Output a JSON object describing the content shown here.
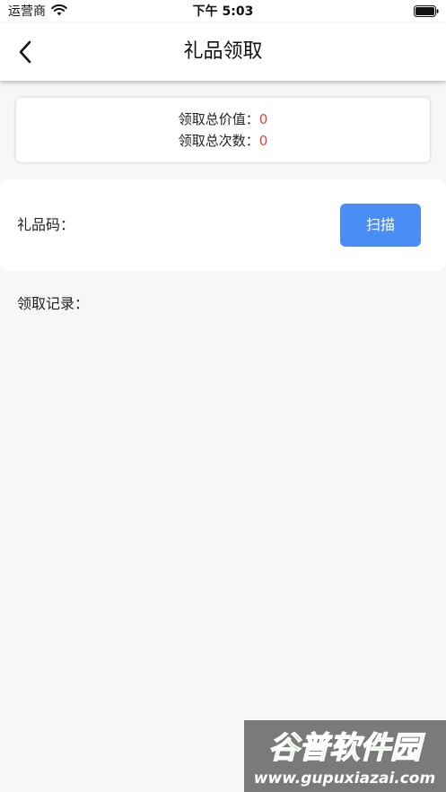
{
  "status_bar": {
    "carrier": "运营商",
    "time": "下午 5:03"
  },
  "nav": {
    "title": "礼品领取",
    "back_icon": "chevron-left-icon"
  },
  "summary": {
    "total_value_label": "领取总价值：",
    "total_value": "0",
    "total_count_label": "领取总次数：",
    "total_count": "0"
  },
  "gift_code": {
    "label": "礼品码：",
    "scan_label": "扫描"
  },
  "records": {
    "label": "领取记录："
  },
  "watermark": {
    "brand": "谷普软件园",
    "url": "www.gupuxiazai.com"
  },
  "colors": {
    "accent": "#4a8ef5",
    "value_red": "#e2463a",
    "background": "#f7f7f7"
  }
}
